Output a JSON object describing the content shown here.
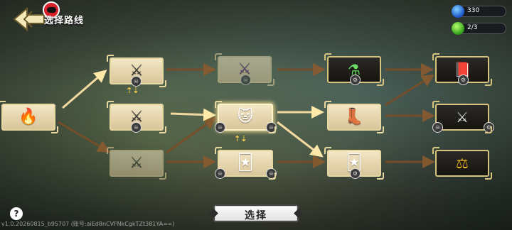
{
  "header": {
    "title": "选择路线",
    "gems": "330",
    "stamina": "2/3"
  },
  "nodes": {
    "campfire": {
      "icon": "🔥",
      "icon_name": "campfire-icon"
    },
    "battle_top_1": {
      "icon": "⚔",
      "icon_name": "crossed-swords-icon"
    },
    "battle_mid_1": {
      "icon": "⚔",
      "icon_name": "crossed-swords-icon"
    },
    "battle_bot_1": {
      "icon": "⚔",
      "icon_name": "crossed-swords-icon"
    },
    "battle_elite_2": {
      "icon": "⚔",
      "icon_name": "purple-crossed-swords-icon"
    },
    "hero_2": {
      "icon": "🐱",
      "icon_name": "cat-hero-portrait"
    },
    "hero_card_2": {
      "icon": "🃏",
      "icon_name": "hero-card-icon"
    },
    "potion_3": {
      "icon": "⚗",
      "icon_name": "green-potion-icon"
    },
    "boots_3": {
      "icon": "👢",
      "icon_name": "boots-icon"
    },
    "hero_card_3": {
      "icon": "🃏",
      "icon_name": "hero-card-icon"
    },
    "book_4": {
      "icon": "📕",
      "icon_name": "spellbook-icon"
    },
    "battle_4": {
      "icon": "⚔",
      "icon_name": "crossed-swords-icon"
    },
    "scales_4": {
      "icon": "⚖",
      "icon_name": "golden-scales-icon"
    }
  },
  "swap_arrows": "⇡⇣",
  "select_button": "选择",
  "help": "?",
  "version": "v1.0.20260815_b95707 (账号:aiEd8nCVFNkCgkTZt381YA==)"
}
